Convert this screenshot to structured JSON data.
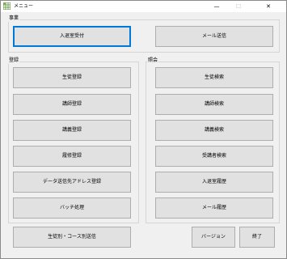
{
  "window": {
    "title": "メニュー",
    "controls": {
      "minimize": "—",
      "maximize": "☐",
      "close": "✕"
    }
  },
  "groups": {
    "business": {
      "label": "事業"
    },
    "register": {
      "label": "登録"
    },
    "inquiry": {
      "label": "照会"
    }
  },
  "buttons": {
    "entry_reception": "入退室受付",
    "send_mail": "メール送信",
    "register_student": "生徒登録",
    "register_instructor": "講師登録",
    "register_lecture": "講義登録",
    "register_enrollment": "履修登録",
    "register_data_address": "データ送信先アドレス登録",
    "batch_process": "バッチ処理",
    "search_student": "生徒検索",
    "search_instructor": "講師検索",
    "search_lecture": "講義検索",
    "search_attendee": "受講者検索",
    "entry_history": "入退室履歴",
    "mail_history": "メール履歴",
    "send_student_course": "生徒別・コース別送信",
    "version": "バージョン",
    "exit": "終了"
  }
}
